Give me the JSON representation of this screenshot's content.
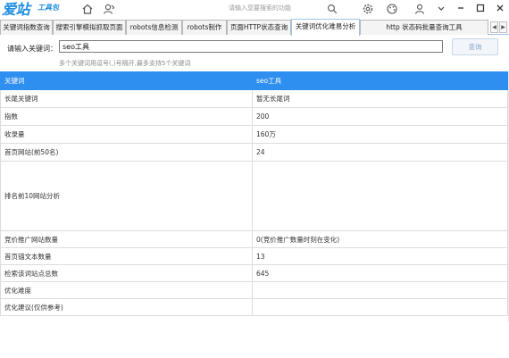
{
  "app": {
    "logo_big": "爱站",
    "logo_small": "工具包"
  },
  "titlebar": {
    "search_placeholder": "请输入您要搜索的功能"
  },
  "tabs": [
    {
      "label": "关键词指数查询"
    },
    {
      "label": "搜索引擎模拟抓取页面"
    },
    {
      "label": "robots信息检测"
    },
    {
      "label": "robots制作"
    },
    {
      "label": "页面HTTP状态查询"
    },
    {
      "label": "关键词优化难易分析",
      "active": true
    },
    {
      "label": "http 状态码批量查询工具"
    }
  ],
  "query": {
    "label": "请输入关键词：",
    "value": "seo工具",
    "button": "查询",
    "hint": "多个关键词用逗号(,)号隔开,最多支持5个关键词"
  },
  "table": {
    "header": {
      "name": "关键词",
      "value": "seo工具"
    },
    "rows": [
      {
        "name": "长尾关键词",
        "value": "暂无长尾词",
        "green": true
      },
      {
        "name": "指数",
        "value": "200"
      },
      {
        "name": "收录量",
        "value": "160万",
        "green": true
      },
      {
        "name": "首页网站(前50名)",
        "value": "24"
      },
      {
        "name": "排名前10网站分析",
        "value": "",
        "tall": true
      },
      {
        "name": "竞价推广网站数量",
        "value": "0(竞价推广数量时刻在变化)"
      },
      {
        "name": "首页锚文本数量",
        "value": "13"
      },
      {
        "name": "检索该词站点总数",
        "value": "645"
      },
      {
        "name": "优化难度",
        "value": ""
      },
      {
        "name": "优化建议(仅供参考)",
        "value": ""
      }
    ]
  }
}
